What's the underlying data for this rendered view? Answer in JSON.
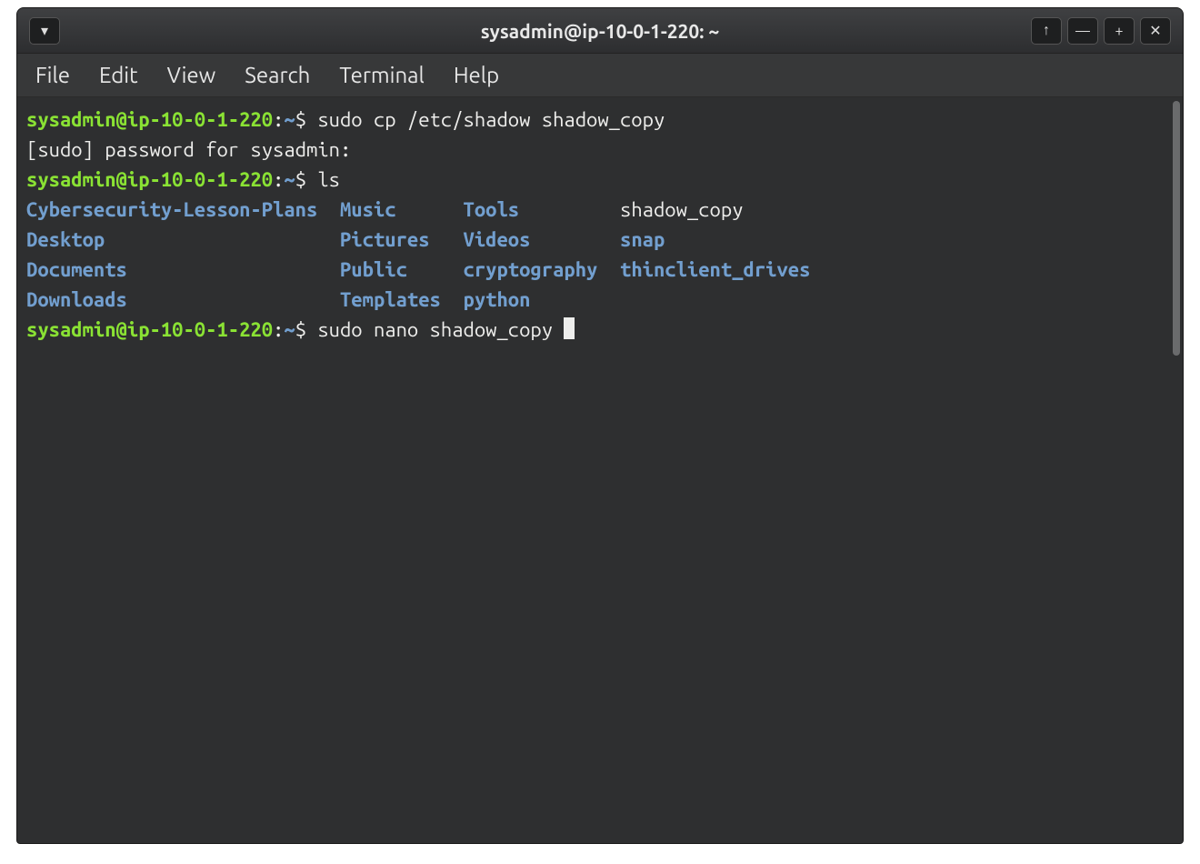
{
  "window": {
    "title": "sysadmin@ip-10-0-1-220: ~"
  },
  "menubar": {
    "items": [
      "File",
      "Edit",
      "View",
      "Search",
      "Terminal",
      "Help"
    ]
  },
  "prompt": {
    "user_host": "sysadmin@ip-10-0-1-220",
    "colon": ":",
    "path": "~",
    "symbol": "$"
  },
  "lines": {
    "cmd1": " sudo cp /etc/shadow shadow_copy",
    "sudo_prompt": "[sudo] password for sysadmin: ",
    "cmd2": " ls",
    "cmd3": " sudo nano shadow_copy "
  },
  "ls": {
    "col1": [
      "Cybersecurity-Lesson-Plans",
      "Desktop",
      "Documents",
      "Downloads"
    ],
    "col2": [
      "Music",
      "Pictures",
      "Public",
      "Templates"
    ],
    "col3": [
      "Tools",
      "Videos",
      "cryptography",
      "python"
    ],
    "col4": [
      "shadow_copy",
      "snap",
      "thinclient_drives",
      ""
    ]
  },
  "icons": {
    "dropdown": "▾",
    "up": "↑",
    "minimize": "—",
    "maximize": "+",
    "close": "✕"
  }
}
